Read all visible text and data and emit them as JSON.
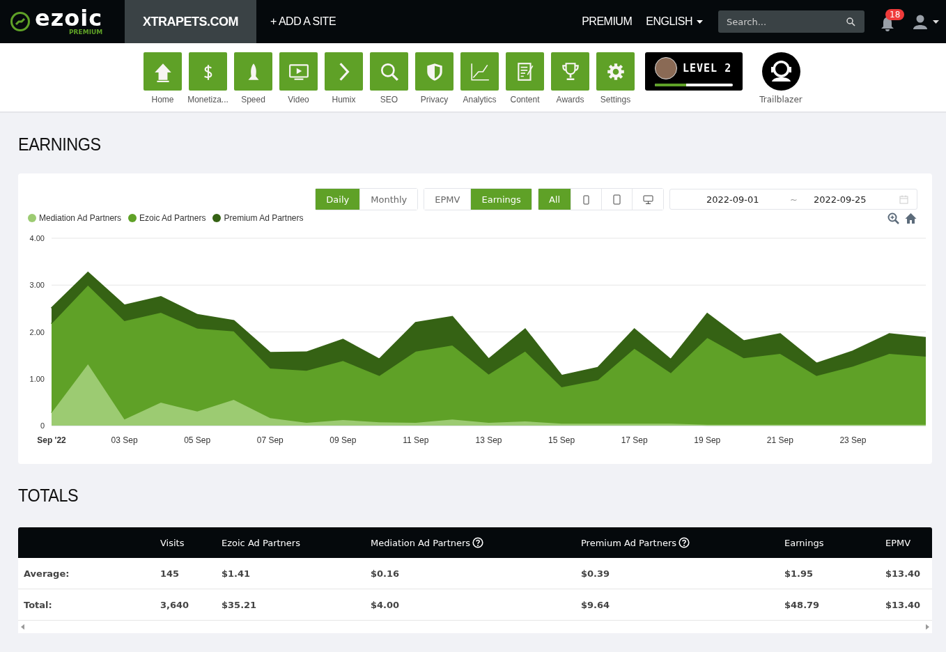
{
  "header": {
    "logo": {
      "wordmark": "ezoic",
      "tier": "PREMIUM"
    },
    "sites": [
      {
        "label": "XTRAPETS.COM",
        "selected": true
      }
    ],
    "add_site": "+ ADD A SITE",
    "premium_link": "PREMIUM",
    "language": "ENGLISH",
    "search": {
      "placeholder": "Search..."
    },
    "notifications": "18"
  },
  "nav": [
    {
      "label": "Home"
    },
    {
      "label": "Monetiza..."
    },
    {
      "label": "Speed"
    },
    {
      "label": "Video"
    },
    {
      "label": "Humix"
    },
    {
      "label": "SEO"
    },
    {
      "label": "Privacy"
    },
    {
      "label": "Analytics"
    },
    {
      "label": "Content"
    },
    {
      "label": "Awards"
    },
    {
      "label": "Settings"
    }
  ],
  "level_badge": {
    "label": "LEVEL 2",
    "level": 0.4
  },
  "achievement": {
    "label": "Trailblazer"
  },
  "earnings": {
    "title": "EARNINGS",
    "period": [
      {
        "label": "Daily",
        "selected": true
      },
      {
        "label": "Monthly",
        "selected": false
      }
    ],
    "metric": [
      {
        "label": "EPMV",
        "selected": false
      },
      {
        "label": "Earnings",
        "selected": true
      }
    ],
    "devices": [
      {
        "kind": "text",
        "label": "All",
        "selected": true
      },
      {
        "kind": "icon",
        "selected": false
      },
      {
        "kind": "icon",
        "selected": false
      },
      {
        "kind": "icon",
        "selected": false
      }
    ],
    "date_range": {
      "start": "2022-09-01",
      "separator": "~",
      "end": "2022-09-25"
    },
    "chart_data": {
      "type": "area",
      "stacked": true,
      "legend": true,
      "categories": [
        "Sep '22",
        null,
        "03 Sep",
        null,
        "05 Sep",
        null,
        "07 Sep",
        null,
        "09 Sep",
        null,
        "11 Sep",
        null,
        "13 Sep",
        null,
        "15 Sep",
        null,
        "17 Sep",
        null,
        "19 Sep",
        null,
        "21 Sep",
        null,
        "23 Sep",
        null,
        null
      ],
      "series": [
        {
          "name": "Mediation Ad Partners",
          "color": "#9ccb72",
          "values": [
            0.27,
            1.31,
            0.13,
            0.49,
            0.3,
            0.55,
            0.16,
            0.06,
            0.12,
            0.07,
            0.06,
            0.13,
            0.06,
            0.09,
            0.04,
            0.04,
            0.04,
            0.04,
            0.02,
            0.02,
            0.02,
            0.02,
            0.02,
            0.02,
            0.02
          ]
        },
        {
          "name": "Ezoic Ad Partners",
          "color": "#5fa127",
          "values": [
            1.9,
            1.68,
            2.1,
            1.92,
            1.77,
            1.46,
            1.06,
            1.11,
            1.26,
            0.99,
            1.52,
            1.58,
            1.03,
            1.49,
            0.78,
            0.93,
            1.6,
            1.08,
            1.85,
            1.42,
            1.51,
            1.04,
            1.24,
            1.51,
            1.45
          ]
        },
        {
          "name": "Premium Ad Partners",
          "color": "#356214",
          "values": [
            0.33,
            0.27,
            0.33,
            0.33,
            0.29,
            0.22,
            0.33,
            0.39,
            0.45,
            0.35,
            0.61,
            0.61,
            0.32,
            0.47,
            0.24,
            0.26,
            0.41,
            0.28,
            0.51,
            0.36,
            0.42,
            0.26,
            0.32,
            0.42,
            0.4
          ]
        }
      ],
      "ylim": [
        0,
        4
      ],
      "yticks": [
        {
          "value": 0,
          "label": "0"
        },
        {
          "value": 1,
          "label": "1.00"
        },
        {
          "value": 2,
          "label": "2.00"
        },
        {
          "value": 3,
          "label": "3.00"
        },
        {
          "value": 4,
          "label": "4.00"
        }
      ]
    }
  },
  "totals": {
    "title": "TOTALS",
    "columns": [
      {
        "label": "Visits",
        "help": false
      },
      {
        "label": "Ezoic Ad Partners",
        "help": false
      },
      {
        "label": "Mediation Ad Partners",
        "help": true
      },
      {
        "label": "Premium Ad Partners",
        "help": true
      },
      {
        "label": "Earnings",
        "help": false
      },
      {
        "label": "EPMV",
        "help": false
      }
    ],
    "rows": [
      {
        "label": "Average:",
        "cells": [
          "145",
          "$1.41",
          "$0.16",
          "$0.39",
          "$1.95",
          "$13.40"
        ]
      },
      {
        "label": "Total:",
        "cells": [
          "3,640",
          "$35.21",
          "$4.00",
          "$9.64",
          "$48.79",
          "$13.40"
        ]
      }
    ]
  }
}
